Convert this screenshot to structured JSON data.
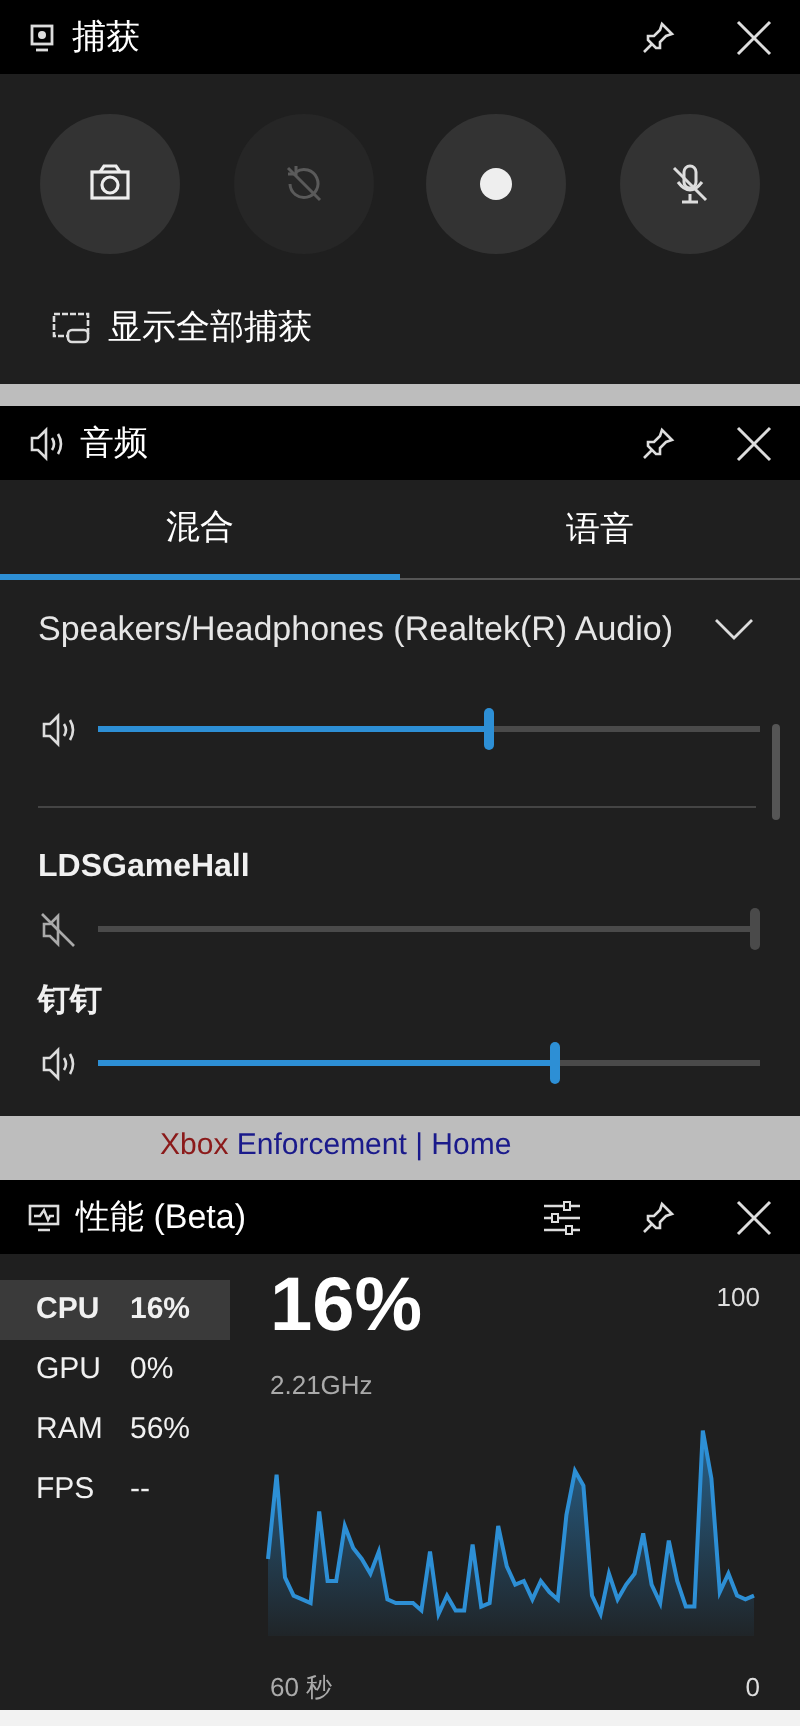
{
  "capture": {
    "title": "捕获",
    "buttons": [
      {
        "kind": "screenshot",
        "disabled": false
      },
      {
        "kind": "record_last",
        "disabled": true
      },
      {
        "kind": "record",
        "disabled": false
      },
      {
        "kind": "mic_off",
        "disabled": false
      }
    ],
    "show_all": "显示全部捕获"
  },
  "audio": {
    "title": "音频",
    "tabs": [
      {
        "label": "混合",
        "selected": true
      },
      {
        "label": "语音",
        "selected": false
      }
    ],
    "device": "Speakers/Headphones (Realtek(R) Audio)",
    "master": {
      "muted": false,
      "level": 0.59
    },
    "apps": [
      {
        "name": "LDSGameHall",
        "muted": true,
        "level": 1.0
      },
      {
        "name": "钉钉",
        "muted": false,
        "level": 0.69
      }
    ]
  },
  "background_page": {
    "link": [
      {
        "text": "Xbox",
        "color": "#8b1a1a"
      },
      {
        "text": "Enforcement | Home",
        "color": "#1a1a8b"
      }
    ]
  },
  "performance": {
    "title": "性能 (Beta)",
    "metrics": [
      {
        "label": "CPU",
        "value": "16%",
        "selected": true
      },
      {
        "label": "GPU",
        "value": "0%",
        "selected": false
      },
      {
        "label": "RAM",
        "value": "56%",
        "selected": false
      },
      {
        "label": "FPS",
        "value": "--",
        "selected": false
      }
    ],
    "big_value": "16%",
    "sub_value": "2.21GHz",
    "graph_max": "100",
    "graph_min": "0",
    "graph_span": "60 秒"
  }
}
